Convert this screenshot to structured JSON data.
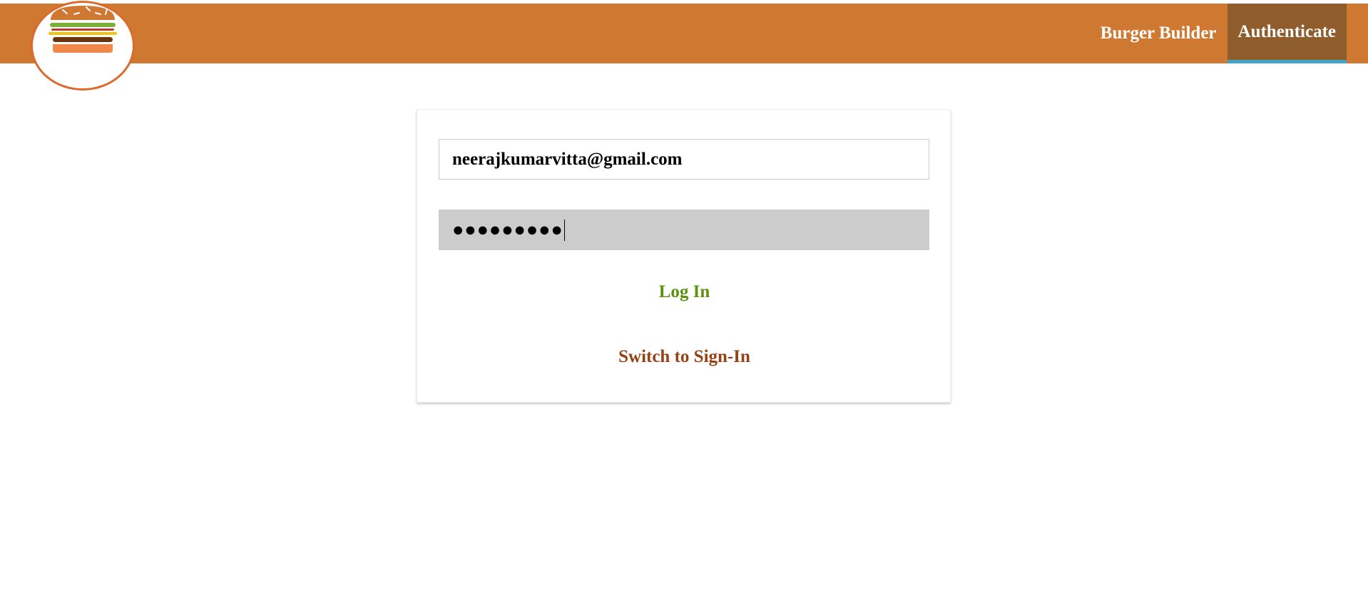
{
  "header": {
    "logo_icon": "burger-logo-icon",
    "nav_items": [
      {
        "label": "Burger Builder",
        "active": false
      },
      {
        "label": "Authenticate",
        "active": true
      }
    ]
  },
  "auth_form": {
    "email_value": "neerajkumarvitta@gmail.com",
    "password_masked": "●●●●●●●●●",
    "login_label": "Log In",
    "switch_label": "Switch to Sign-In"
  },
  "colors": {
    "toolbar": "#CF7831",
    "active_nav": "#8F5C2C",
    "active_underline": "#40A4C8",
    "login": "#5C9210",
    "switch": "#944317"
  }
}
